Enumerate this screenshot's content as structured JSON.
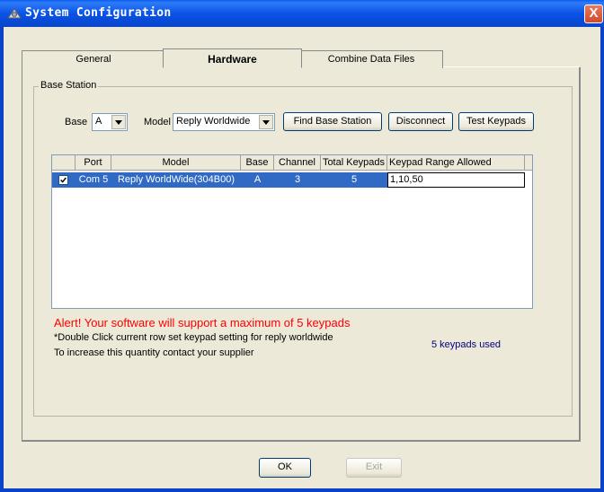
{
  "window": {
    "title": "System Configuration",
    "close_glyph": "X"
  },
  "tabs": [
    {
      "label": "General",
      "active": false
    },
    {
      "label": "Hardware",
      "active": true
    },
    {
      "label": "Combine Data Files",
      "active": false
    }
  ],
  "base_station": {
    "group_label": "Base Station",
    "base_label": "Base",
    "base_value": "A",
    "model_label": "Model",
    "model_value": "Reply Worldwide",
    "buttons": {
      "find": "Find Base Station",
      "disconnect": "Disconnect",
      "test": "Test Keypads"
    }
  },
  "table": {
    "headers": [
      "",
      "Port",
      "Model",
      "Base",
      "Channel",
      "Total Keypads",
      "Keypad Range Allowed"
    ],
    "rows": [
      {
        "checked": true,
        "port": "Com 5",
        "model": "Reply WorldWide(304B00)",
        "base": "A",
        "channel": "3",
        "total": "5",
        "range": "1,10,50"
      }
    ]
  },
  "messages": {
    "alert": "Alert! Your software will support a maximum of 5 keypads",
    "hint": "*Double Click current row set keypad setting for reply worldwide",
    "contact": "To increase this quantity contact your supplier",
    "used": "5 keypads used"
  },
  "footer": {
    "ok": "OK",
    "exit": "Exit"
  },
  "colors": {
    "titlebar": "#0a52e6",
    "selection": "#316ac5",
    "alert": "#ff0000",
    "used": "#000080"
  },
  "icons": {
    "title": "settings-icon",
    "close": "close-icon",
    "check": "checkbox-checked-icon"
  }
}
